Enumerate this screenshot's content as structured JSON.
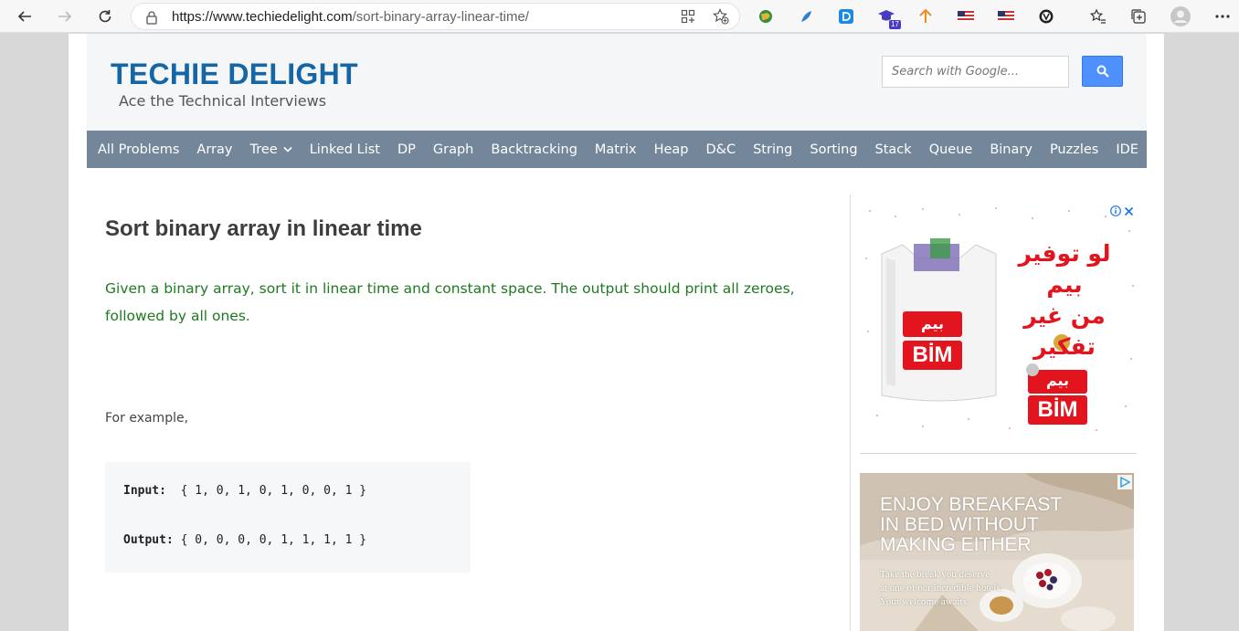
{
  "browser": {
    "url_host": "https://www.techiedelight.com",
    "url_path": "/sort-binary-array-linear-time/",
    "extension_badge": "17"
  },
  "site": {
    "logo": "TECHIE DELIGHT",
    "tagline": "Ace the Technical Interviews",
    "search_placeholder": "Search with Google..."
  },
  "menu": [
    {
      "label": "All Problems"
    },
    {
      "label": "Array"
    },
    {
      "label": "Tree",
      "dropdown": true
    },
    {
      "label": "Linked List"
    },
    {
      "label": "DP"
    },
    {
      "label": "Graph"
    },
    {
      "label": "Backtracking"
    },
    {
      "label": "Matrix"
    },
    {
      "label": "Heap"
    },
    {
      "label": "D&C"
    },
    {
      "label": "String"
    },
    {
      "label": "Sorting"
    },
    {
      "label": "Stack"
    },
    {
      "label": "Queue"
    },
    {
      "label": "Binary"
    },
    {
      "label": "Puzzles"
    },
    {
      "label": "IDE"
    }
  ],
  "article": {
    "title": "Sort binary array in linear time",
    "lead": "Given a binary array, sort it in linear time and constant space. The output should print all zeroes, followed by all ones.",
    "example_label": "For example,",
    "code": {
      "input_label": "Input:",
      "input_value": "  { 1, 0, 1, 0, 1, 0, 0, 1 }",
      "output_label": "Output:",
      "output_value": " { 0, 0, 0, 0, 1, 1, 1, 1 }"
    }
  },
  "ads": {
    "ad1": {
      "arabic_line1": "لو توفير",
      "arabic_line2": "بيم",
      "arabic_line3": "من غير تفكير",
      "brand_arabic": "بيم",
      "brand_latin": "BİM"
    },
    "ad2": {
      "title_lines": [
        "ENJOY BREAKFAST",
        "IN BED WITHOUT",
        "MAKING EITHER"
      ],
      "sub_lines": [
        "Take the break you deserve",
        "at one of our incredible hotels.",
        "Your welcome awaits."
      ]
    }
  },
  "colors": {
    "logo": "#1466a6",
    "menu_bg": "#74869a",
    "lead_text": "#1e7a1e",
    "search_button": "#4d90fe"
  }
}
